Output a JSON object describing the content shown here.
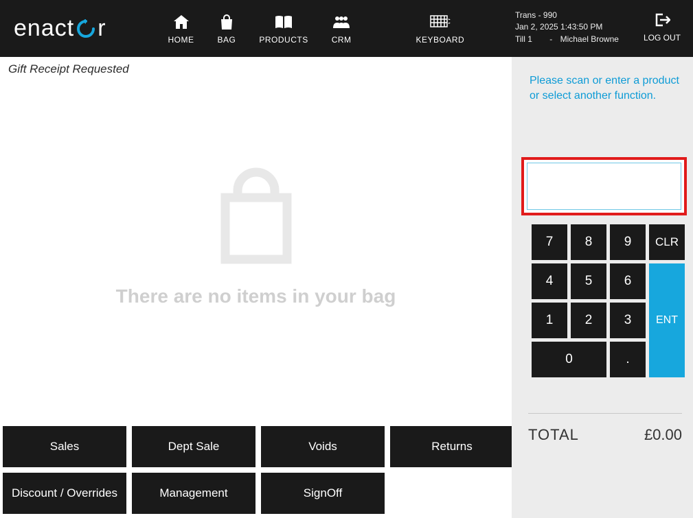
{
  "header": {
    "nav": {
      "home": "HOME",
      "bag": "BAG",
      "products": "PRODUCTS",
      "crm": "CRM",
      "keyboard": "KEYBOARD"
    },
    "session": {
      "trans": "Trans - 990",
      "datetime": "Jan 2, 2025 1:43:50 PM",
      "till": "Till 1",
      "dash": "-",
      "user": "Michael Browne"
    },
    "logout": "LOG OUT"
  },
  "left": {
    "gift_label": "Gift Receipt Requested",
    "empty_bag_msg": "There are no items in your bag",
    "actions": {
      "sales": "Sales",
      "dept_sale": "Dept Sale",
      "voids": "Voids",
      "returns": "Returns",
      "discount": "Discount / Overrides",
      "management": "Management",
      "signoff": "SignOff"
    }
  },
  "right": {
    "prompt": "Please scan or enter a product or select another function.",
    "input_value": "",
    "keypad": {
      "k7": "7",
      "k8": "8",
      "k9": "9",
      "clr": "CLR",
      "k4": "4",
      "k5": "5",
      "k6": "6",
      "k1": "1",
      "k2": "2",
      "k3": "3",
      "k0": "0",
      "dot": ".",
      "ent": "ENT"
    },
    "total_label": "TOTAL",
    "total_value": "£0.00"
  }
}
